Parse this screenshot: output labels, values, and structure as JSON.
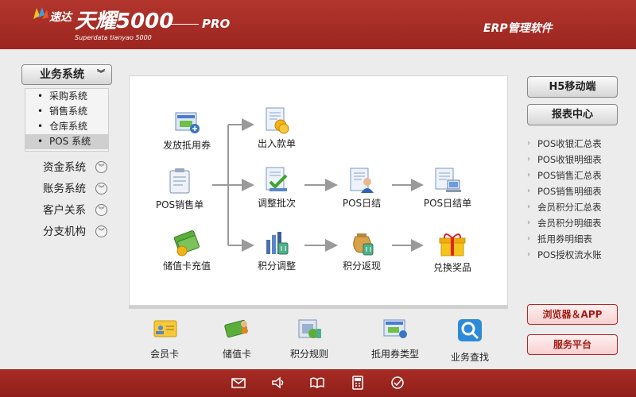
{
  "header": {
    "brand_cn": "速达",
    "product_title": "天耀5000",
    "edition": "PRO",
    "subtitle": "Superdata tianyao 5000",
    "app_name": "ERP管理软件"
  },
  "sidebar": {
    "system_button": "业务系统",
    "sub_items": [
      "采购系统",
      "销售系统",
      "仓库系统",
      "POS 系统"
    ],
    "nav_items": [
      "资金系统",
      "账务系统",
      "客户关系",
      "分支机构"
    ]
  },
  "flow": {
    "nodes": {
      "issue_coupon": "发放抵用券",
      "cash_in_out": "出入款单",
      "pos_sales": "POS销售单",
      "adjust_batch": "调整批次",
      "pos_daily": "POS日结",
      "pos_daily_form": "POS日结单",
      "stored_recharge": "储值卡充值",
      "points_adjust": "积分调整",
      "points_refund": "积分返现",
      "redeem_prize": "兑换奖品"
    }
  },
  "toolbar": {
    "items": [
      "会员卡",
      "储值卡",
      "积分规则",
      "抵用券类型",
      "业务查找"
    ]
  },
  "right": {
    "h5_button": "H5移动端",
    "report_button": "报表中心",
    "reports": [
      "POS收银汇总表",
      "POS收银明细表",
      "POS销售汇总表",
      "POS销售明细表",
      "会员积分汇总表",
      "会员积分明细表",
      "抵用券明细表",
      "POS授权流水账"
    ],
    "browser_app_button": "浏览器＆APP",
    "service_button": "服务平台"
  },
  "footer": {
    "icons": [
      "mail-icon",
      "volume-icon",
      "book-icon",
      "calculator-icon",
      "check-icon"
    ]
  },
  "colors": {
    "header_red": "#a82c25",
    "panel_white": "#ffffff",
    "arrow_gray": "#9a9a9a"
  }
}
